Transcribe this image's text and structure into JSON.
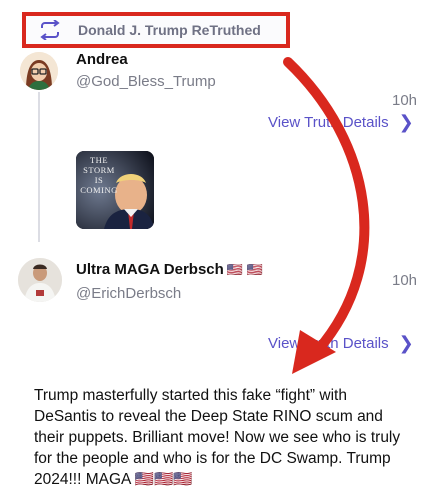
{
  "retruth": {
    "label": "Donald J. Trump ReTruthed",
    "icon": "retruth-icon",
    "border_color": "#d9281e"
  },
  "post1": {
    "author": "Andrea",
    "handle": "@God_Bless_Trump",
    "time": "10h",
    "details_label": "View Truth Details",
    "media": {
      "caption_lines": [
        "THE",
        "STORM",
        "IS",
        "COMING"
      ]
    }
  },
  "post2": {
    "author": "Ultra MAGA Derbsch",
    "author_flags": "🇺🇸 🇺🇸",
    "handle": "@ErichDerbsch",
    "time": "10h",
    "details_label": "View Truth Details",
    "text": "Trump masterfully started this fake “fight” with DeSantis to reveal the Deep State RINO scum and their puppets. Brilliant move! Now we see who is truly for the people and who is for the DC Swamp. Trump 2024!!! MAGA 🇺🇸🇺🇸🇺🇸"
  },
  "colors": {
    "link": "#5a52c8",
    "muted": "#7a7c88",
    "annotation_red": "#d9281e"
  }
}
